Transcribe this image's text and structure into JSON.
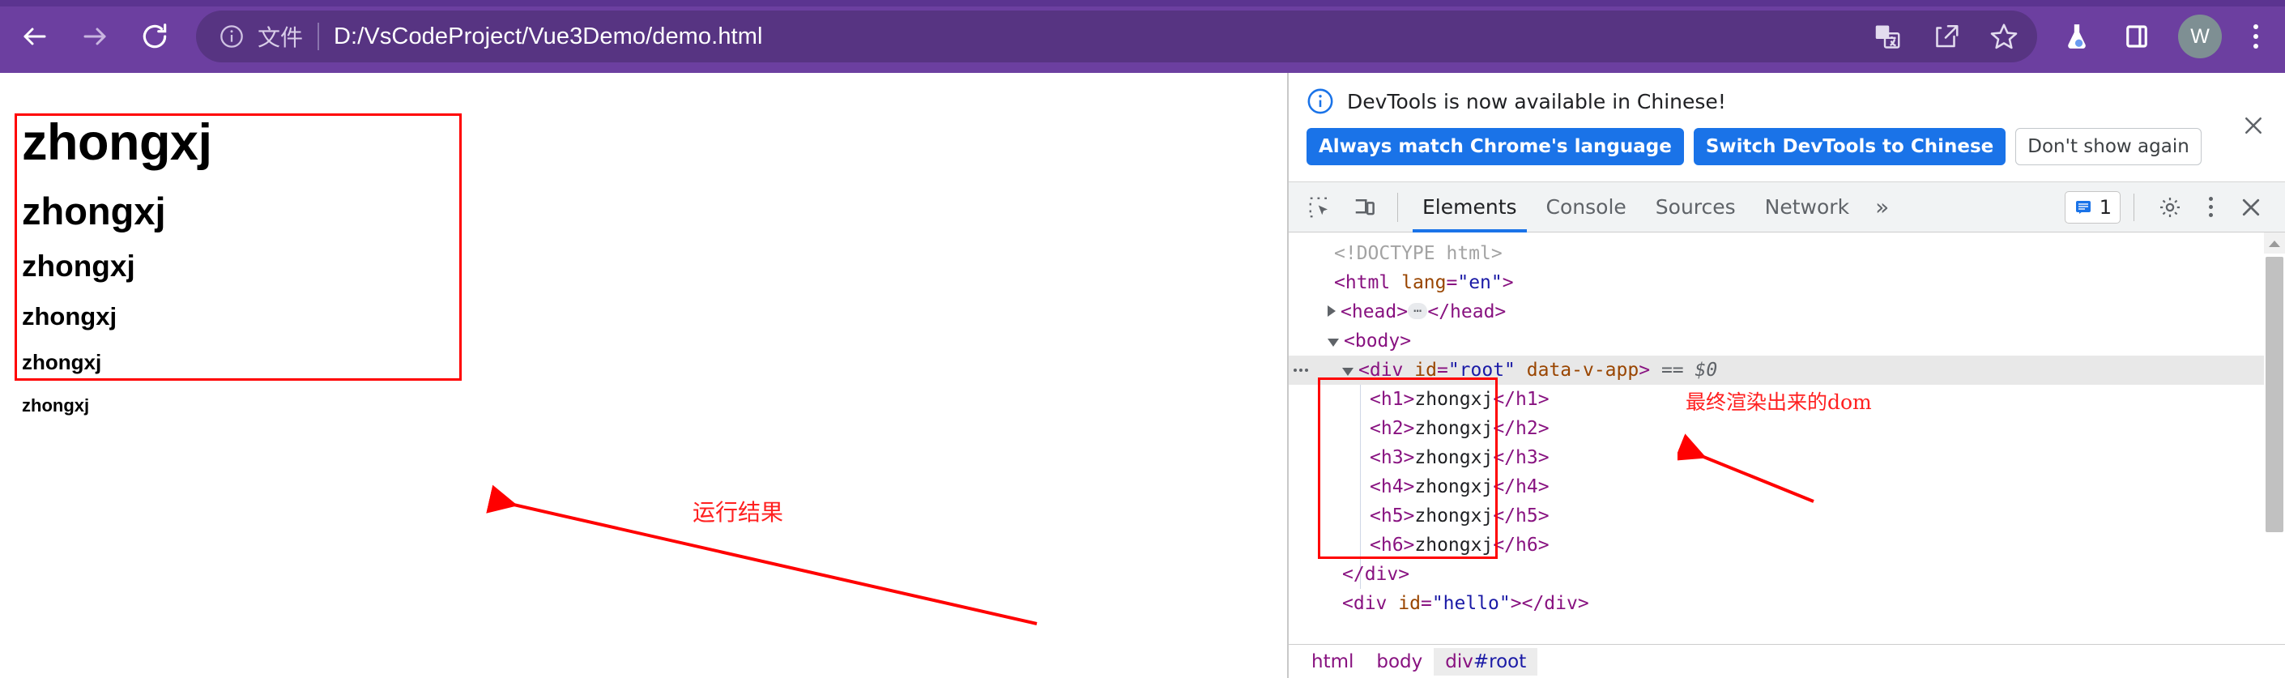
{
  "browser": {
    "nav": {
      "back_icon": "arrow-left-icon",
      "forward_icon": "arrow-right-icon",
      "reload_icon": "reload-icon"
    },
    "omnibox": {
      "site_info_icon": "info-circle-icon",
      "scheme_label": "文件",
      "url": "D:/VsCodeProject/Vue3Demo/demo.html",
      "translate_icon": "translate-icon",
      "share_icon": "share-icon",
      "bookmark_icon": "star-icon"
    },
    "toolbar_right": {
      "experiments_icon": "flask-icon",
      "side_panel_icon": "side-panel-icon",
      "profile_initial": "W",
      "menu_icon": "kebab-menu-icon"
    },
    "theme_color": "#6c3fa0",
    "omnibox_color": "#573482"
  },
  "page": {
    "headings": [
      {
        "tag": "h1",
        "text": "zhongxj"
      },
      {
        "tag": "h2",
        "text": "zhongxj"
      },
      {
        "tag": "h3",
        "text": "zhongxj"
      },
      {
        "tag": "h4",
        "text": "zhongxj"
      },
      {
        "tag": "h5",
        "text": "zhongxj"
      },
      {
        "tag": "h6",
        "text": "zhongxj"
      }
    ],
    "highlight_color": "#ff0000"
  },
  "annotations": {
    "left": {
      "text": "运行结果",
      "color": "#ff2020"
    },
    "right": {
      "text": "最终渲染出来的dom",
      "color": "#ff2020"
    }
  },
  "devtools": {
    "banner": {
      "info_icon": "info-circle-icon",
      "title": "DevTools is now available in Chinese!",
      "buttons": [
        {
          "label": "Always match Chrome's language",
          "style": "primary"
        },
        {
          "label": "Switch DevTools to Chinese",
          "style": "primary"
        },
        {
          "label": "Don't show again",
          "style": "secondary"
        }
      ],
      "close_icon": "close-icon",
      "accent_color": "#1a73e8"
    },
    "tabbar": {
      "inspect_icon": "inspect-element-icon",
      "device_icon": "device-toolbar-icon",
      "tabs": [
        {
          "label": "Elements",
          "active": true
        },
        {
          "label": "Console",
          "active": false
        },
        {
          "label": "Sources",
          "active": false
        },
        {
          "label": "Network",
          "active": false
        }
      ],
      "more_tabs": "»",
      "message_badge": {
        "icon": "message-icon",
        "count": "1"
      },
      "settings_icon": "gear-icon",
      "kebab_icon": "kebab-menu-icon",
      "close_icon": "close-icon"
    },
    "tree": [
      {
        "kind": "doctype",
        "text": "<!DOCTYPE html>"
      },
      {
        "kind": "open",
        "tag": "html",
        "attrs": [
          {
            "name": "lang",
            "value": "\"en\""
          }
        ]
      },
      {
        "kind": "collapsed",
        "tag": "head"
      },
      {
        "kind": "open",
        "tag": "body"
      },
      {
        "kind": "selected",
        "tag": "div",
        "attrs": [
          {
            "name": "id",
            "value": "\"root\""
          },
          {
            "name": "data-v-app",
            "value": ""
          }
        ],
        "suffix": "== $0"
      },
      {
        "kind": "leaf",
        "tag": "h1",
        "text": "zhongxj"
      },
      {
        "kind": "leaf",
        "tag": "h2",
        "text": "zhongxj"
      },
      {
        "kind": "leaf",
        "tag": "h3",
        "text": "zhongxj"
      },
      {
        "kind": "leaf",
        "tag": "h4",
        "text": "zhongxj"
      },
      {
        "kind": "leaf",
        "tag": "h5",
        "text": "zhongxj"
      },
      {
        "kind": "leaf",
        "tag": "h6",
        "text": "zhongxj"
      },
      {
        "kind": "close",
        "tag": "div"
      },
      {
        "kind": "empty",
        "tag": "div",
        "attrs": [
          {
            "name": "id",
            "value": "\"hello\""
          }
        ]
      }
    ],
    "breadcrumb": [
      {
        "label": "html",
        "active": false
      },
      {
        "label": "body",
        "active": false
      },
      {
        "label": "div",
        "hash": "#root",
        "active": true
      }
    ]
  }
}
